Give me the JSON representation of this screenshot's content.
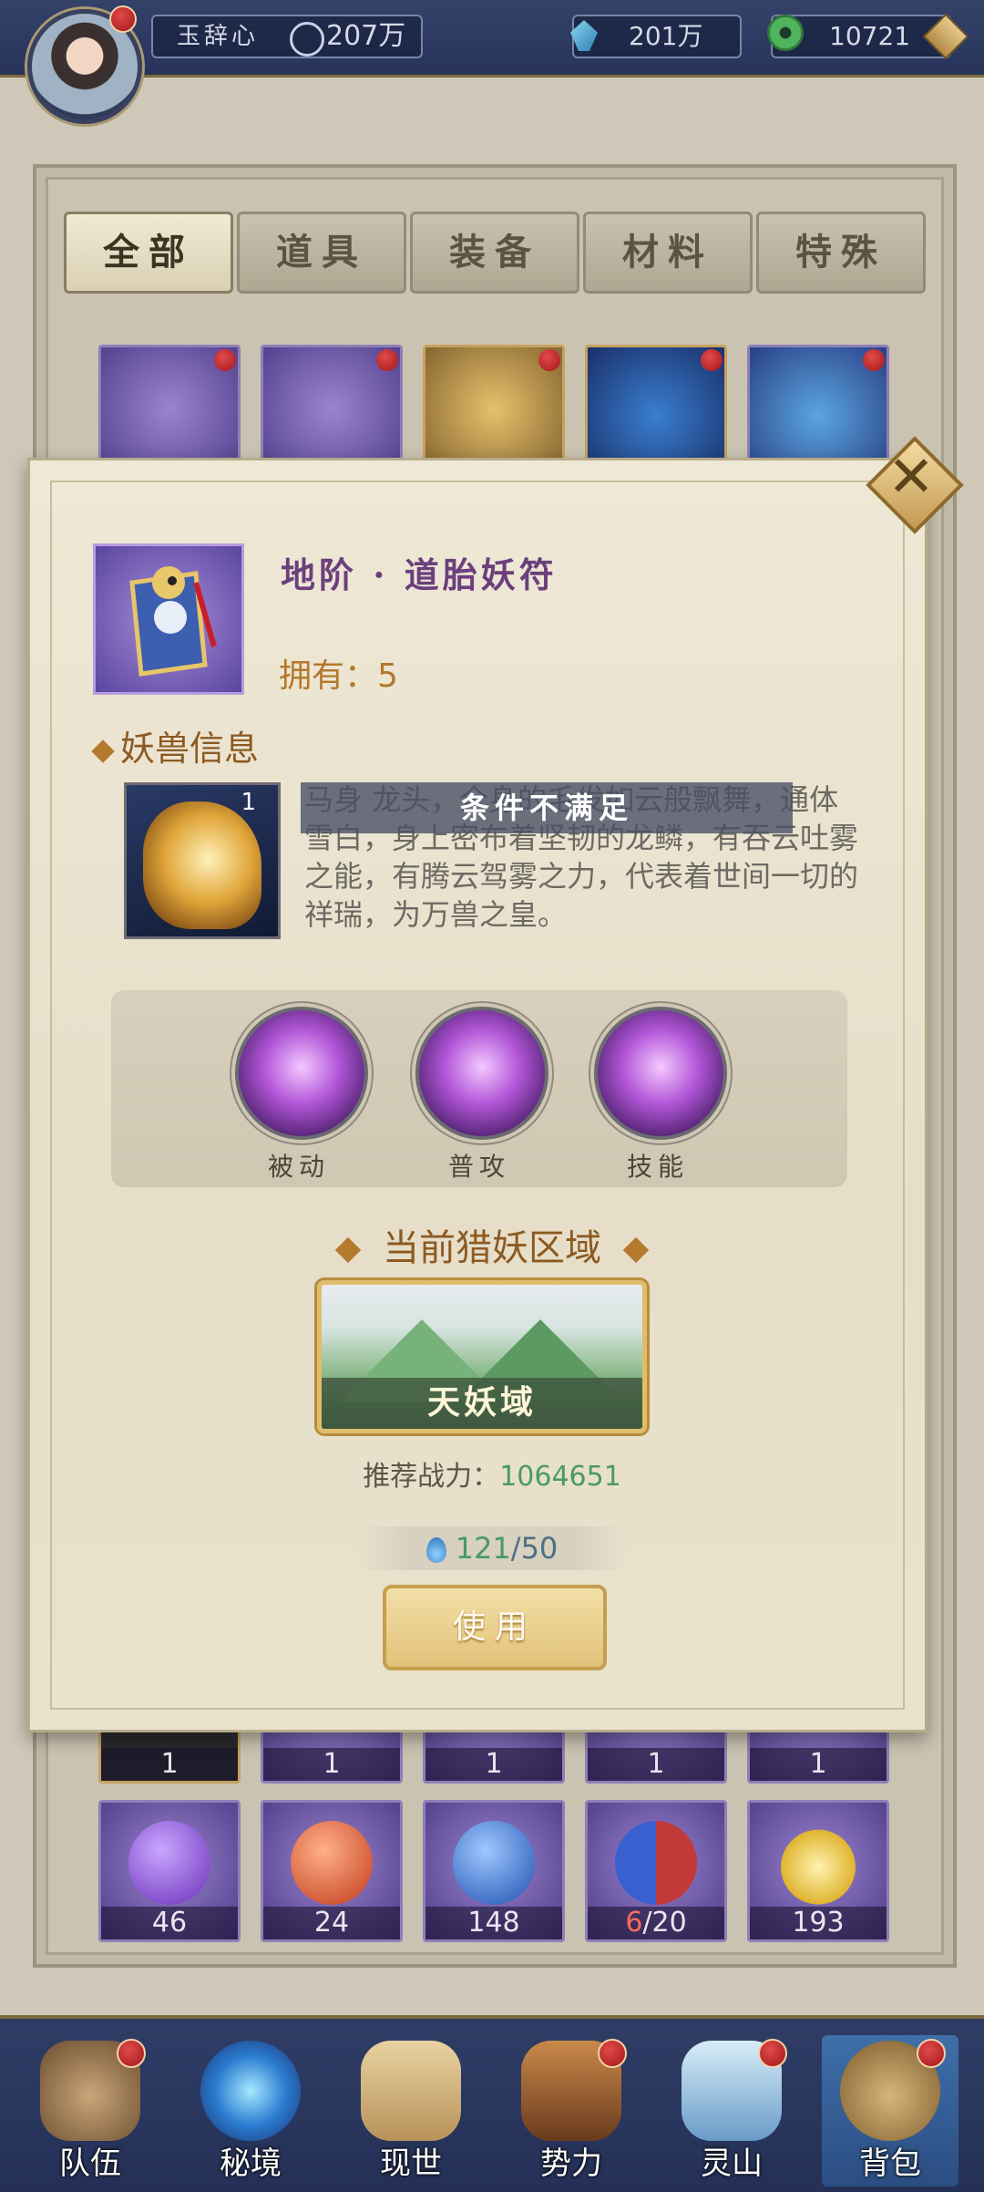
{
  "topbar": {
    "player_name": "玉辞心",
    "power": "207万",
    "gems": "201万",
    "jade": "10721"
  },
  "tabs": [
    {
      "label": "全部",
      "active": true
    },
    {
      "label": "道具",
      "active": false
    },
    {
      "label": "装备",
      "active": false
    },
    {
      "label": "材料",
      "active": false
    },
    {
      "label": "特殊",
      "active": false
    }
  ],
  "grid": {
    "row1": [
      "",
      "",
      "",
      "",
      ""
    ],
    "row2": [
      "1",
      "1",
      "1",
      "1",
      "1"
    ],
    "row3": [
      {
        "count": "46"
      },
      {
        "count": "24"
      },
      {
        "count": "148"
      },
      {
        "have": "6",
        "need": "/20"
      },
      {
        "count": "193"
      }
    ]
  },
  "popup": {
    "item_name": "地阶 · 道胎妖符",
    "owned_label": "拥有：5",
    "beast_section": "妖兽信息",
    "beast_level": "1",
    "beast_desc": "马身   龙头，全身的毛发如云般飘舞，通体雪白，身上密布着坚韧的龙鳞，有吞云吐雾之能，有腾云驾雾之力，代表着世间一切的祥瑞，为万兽之皇。",
    "warning": "条件不满足",
    "skills": [
      {
        "label": "被动"
      },
      {
        "label": "普攻"
      },
      {
        "label": "技能"
      }
    ],
    "region_section": "当前猎妖区域",
    "region_name": "天妖域",
    "power_label": "推荐战力：",
    "power_value": "1064651",
    "cost_have": "121",
    "cost_need": "/50",
    "use_button": "使用"
  },
  "nav": [
    {
      "label": "队伍",
      "badge": true
    },
    {
      "label": "秘境",
      "badge": false
    },
    {
      "label": "现世",
      "badge": false
    },
    {
      "label": "势力",
      "badge": true
    },
    {
      "label": "灵山",
      "badge": true
    },
    {
      "label": "背包",
      "badge": true,
      "active": true
    }
  ],
  "colors": {
    "topbar": "#2b375e",
    "popup_bg": "#ece5d2",
    "accent_gold": "#b4792c",
    "power_green": "#4a9a63",
    "badge_red": "#c62828"
  }
}
